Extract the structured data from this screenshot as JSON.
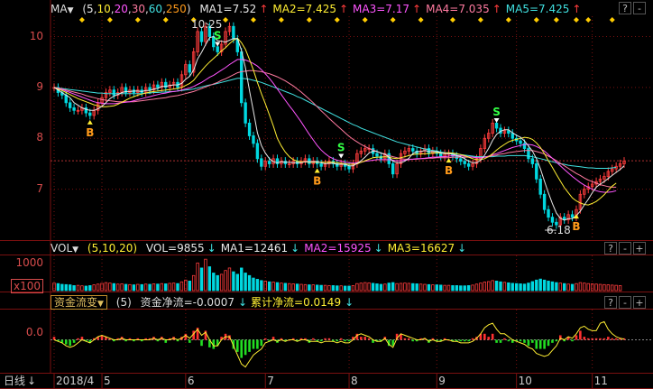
{
  "colors": {
    "background": "#000000",
    "grid_red": "#7a1010",
    "up": "#ff3c3c",
    "down": "#00d8e0",
    "ma1": "#e8e8e8",
    "ma2": "#ffee33",
    "ma3": "#ff55ff",
    "ma4": "#ff7aa0",
    "ma5": "#40e0e0",
    "signal_b": "#ff9a1a",
    "signal_s": "#33ff44",
    "flow_pos": "#ff3030",
    "flow_neg": "#22dd22",
    "flow_line": "#ffee33"
  },
  "price_panel": {
    "indicator_name": "MA",
    "dropdown_icon": "triangle-down-icon",
    "params": [
      "5",
      "10",
      "20",
      "30",
      "60",
      "250"
    ],
    "ma_values": [
      {
        "label": "MA1=7.52",
        "color": "#e8e8e8"
      },
      {
        "label": "MA2=7.425",
        "color": "#ffee33"
      },
      {
        "label": "MA3=7.17",
        "color": "#ff55ff"
      },
      {
        "label": "MA4=7.035",
        "color": "#ff7aa0"
      },
      {
        "label": "MA5=7.425",
        "color": "#40e0e0"
      }
    ],
    "y_ticks": [
      "10",
      "9",
      "8",
      "7"
    ],
    "high_label": "10.25",
    "low_label": "6.18",
    "reference_price": 7.56
  },
  "volume_panel": {
    "indicator_name": "VOL",
    "params": "(5,10,20)",
    "values": [
      {
        "label": "VOL=9855",
        "color": "#e8e8e8"
      },
      {
        "label": "MA1=12461",
        "color": "#e8e8e8"
      },
      {
        "label": "MA2=15925",
        "color": "#ff55ff"
      },
      {
        "label": "MA3=16627",
        "color": "#ffee33"
      }
    ],
    "y_tick": "1000",
    "unit": "x100"
  },
  "flow_panel": {
    "indicator_name": "资金流变",
    "param": "(5)",
    "net_label": "资金净流=-0.0007",
    "cum_label": "累计净流=0.0149",
    "y_tick": "0.0"
  },
  "controls": [
    "?",
    "-",
    "+"
  ],
  "time_axis": {
    "period_label": "日线",
    "period_icon": "arrow-down-icon",
    "ticks": [
      "2018/4",
      "5",
      "6",
      "7",
      "8",
      "9",
      "10",
      "11"
    ]
  },
  "chart_data": {
    "type": "candlestick",
    "title": "",
    "x": [
      "2018/4",
      "5",
      "6",
      "7",
      "8",
      "9",
      "10",
      "11"
    ],
    "price_range": [
      6.0,
      10.4
    ],
    "closes": [
      9.0,
      8.9,
      8.85,
      8.7,
      8.6,
      8.55,
      8.55,
      8.6,
      8.5,
      8.45,
      8.55,
      8.7,
      8.8,
      8.9,
      8.95,
      8.85,
      8.9,
      9.0,
      8.9,
      8.95,
      8.9,
      8.95,
      8.9,
      9.0,
      8.95,
      9.05,
      9.0,
      9.1,
      9.0,
      9.05,
      9.1,
      9.0,
      9.25,
      9.45,
      9.3,
      9.7,
      10.1,
      9.9,
      10.2,
      10.0,
      9.8,
      9.7,
      9.85,
      10.1,
      10.2,
      9.95,
      9.7,
      8.7,
      8.3,
      8.05,
      7.9,
      7.6,
      7.45,
      7.55,
      7.5,
      7.6,
      7.5,
      7.55,
      7.5,
      7.5,
      7.55,
      7.5,
      7.55,
      7.6,
      7.5,
      7.55,
      7.5,
      7.45,
      7.5,
      7.55,
      7.5,
      7.45,
      7.5,
      7.45,
      7.4,
      7.5,
      7.7,
      7.75,
      7.8,
      7.8,
      7.7,
      7.65,
      7.6,
      7.7,
      7.5,
      7.3,
      7.5,
      7.7,
      7.75,
      7.8,
      7.75,
      7.7,
      7.75,
      7.8,
      7.7,
      7.75,
      7.7,
      7.65,
      7.7,
      7.7,
      7.65,
      7.6,
      7.55,
      7.5,
      7.45,
      7.5,
      7.6,
      7.8,
      8.0,
      8.1,
      8.3,
      8.2,
      8.1,
      8.15,
      8.1,
      8.0,
      7.95,
      7.9,
      7.8,
      7.6,
      7.5,
      7.2,
      6.9,
      6.6,
      6.45,
      6.35,
      6.3,
      6.45,
      6.4,
      6.5,
      6.45,
      6.6,
      6.9,
      7.0,
      7.05,
      7.1,
      7.15,
      7.2,
      7.25,
      7.35,
      7.4,
      7.45,
      7.5,
      7.55
    ],
    "ma1": [
      9.0,
      8.95,
      8.9,
      8.85,
      8.8,
      8.7,
      8.65,
      8.6,
      8.57,
      8.55,
      8.55,
      8.58,
      8.63,
      8.7,
      8.78,
      8.83,
      8.86,
      8.9,
      8.92,
      8.92,
      8.93,
      8.93,
      8.92,
      8.94,
      8.94,
      8.97,
      8.98,
      9.02,
      9.02,
      9.04,
      9.05,
      9.05,
      9.08,
      9.16,
      9.22,
      9.34,
      9.56,
      9.69,
      9.84,
      9.98,
      10.0,
      9.92,
      9.91,
      9.89,
      9.93,
      9.96,
      9.96,
      9.73,
      9.39,
      8.94,
      8.53,
      8.11,
      7.86,
      7.71,
      7.6,
      7.54,
      7.52,
      7.54,
      7.53,
      7.53,
      7.52,
      7.52,
      7.52,
      7.54,
      7.54,
      7.54,
      7.54,
      7.52,
      7.5,
      7.51,
      7.51,
      7.49,
      7.49,
      7.49,
      7.46,
      7.46,
      7.51,
      7.56,
      7.63,
      7.71,
      7.75,
      7.74,
      7.71,
      7.69,
      7.63,
      7.55,
      7.52,
      7.52,
      7.55,
      7.61,
      7.7,
      7.74,
      7.74,
      7.76,
      7.74,
      7.74,
      7.74,
      7.72,
      7.7,
      7.7,
      7.69,
      7.66,
      7.64,
      7.6,
      7.55,
      7.52,
      7.52,
      7.57,
      7.67,
      7.8,
      7.96,
      8.08,
      8.14,
      8.17,
      8.17,
      8.11,
      8.06,
      8.02,
      7.95,
      7.85,
      7.75,
      7.6,
      7.4,
      7.16,
      6.93,
      6.72,
      6.53,
      6.43,
      6.39,
      6.42,
      6.42,
      6.48,
      6.57,
      6.69,
      6.8,
      6.93,
      7.04,
      7.1,
      7.15,
      7.21,
      7.27,
      7.33,
      7.39,
      7.46
    ],
    "ma2": [
      9.0,
      8.97,
      8.94,
      8.9,
      8.86,
      8.82,
      8.78,
      8.75,
      8.72,
      8.69,
      8.66,
      8.64,
      8.62,
      8.62,
      8.63,
      8.64,
      8.67,
      8.71,
      8.75,
      8.79,
      8.82,
      8.85,
      8.87,
      8.89,
      8.91,
      8.92,
      8.93,
      8.94,
      8.95,
      8.96,
      8.97,
      8.98,
      9.0,
      9.04,
      9.08,
      9.14,
      9.24,
      9.33,
      9.42,
      9.5,
      9.57,
      9.64,
      9.72,
      9.78,
      9.86,
      9.93,
      9.97,
      9.88,
      9.75,
      9.55,
      9.34,
      9.1,
      8.88,
      8.68,
      8.46,
      8.24,
      8.0,
      7.85,
      7.73,
      7.64,
      7.58,
      7.55,
      7.54,
      7.54,
      7.53,
      7.53,
      7.53,
      7.53,
      7.53,
      7.53,
      7.53,
      7.52,
      7.51,
      7.5,
      7.49,
      7.49,
      7.5,
      7.53,
      7.56,
      7.59,
      7.62,
      7.63,
      7.63,
      7.64,
      7.63,
      7.61,
      7.6,
      7.62,
      7.64,
      7.66,
      7.68,
      7.69,
      7.69,
      7.7,
      7.7,
      7.71,
      7.72,
      7.71,
      7.71,
      7.72,
      7.71,
      7.7,
      7.68,
      7.66,
      7.63,
      7.6,
      7.58,
      7.58,
      7.6,
      7.64,
      7.7,
      7.77,
      7.83,
      7.88,
      7.93,
      7.96,
      7.98,
      8.0,
      8.02,
      8.01,
      7.98,
      7.91,
      7.82,
      7.7,
      7.56,
      7.43,
      7.29,
      7.16,
      7.03,
      6.93,
      6.83,
      6.77,
      6.73,
      6.7,
      6.69,
      6.72,
      6.76,
      6.82,
      6.89,
      6.98,
      7.06,
      7.12
    ],
    "ma3": [
      9.0,
      8.98,
      8.96,
      8.93,
      8.9,
      8.87,
      8.84,
      8.81,
      8.78,
      8.75,
      8.72,
      8.7,
      8.69,
      8.68,
      8.68,
      8.68,
      8.69,
      8.7,
      8.71,
      8.72,
      8.74,
      8.76,
      8.78,
      8.8,
      8.82,
      8.84,
      8.86,
      8.88,
      8.89,
      8.91,
      8.92,
      8.93,
      8.95,
      8.97,
      8.99,
      9.02,
      9.06,
      9.1,
      9.15,
      9.2,
      9.24,
      9.29,
      9.34,
      9.39,
      9.45,
      9.5,
      9.55,
      9.55,
      9.54,
      9.51,
      9.47,
      9.42,
      9.35,
      9.27,
      9.18,
      9.08,
      8.97,
      8.86,
      8.75,
      8.64,
      8.54,
      8.43,
      8.32,
      8.2,
      8.08,
      7.97,
      7.86,
      7.77,
      7.7,
      7.64,
      7.6,
      7.57,
      7.55,
      7.53,
      7.52,
      7.51,
      7.52,
      7.53,
      7.55,
      7.56,
      7.57,
      7.58,
      7.58,
      7.58,
      7.58,
      7.57,
      7.56,
      7.56,
      7.57,
      7.58,
      7.59,
      7.6,
      7.6,
      7.61,
      7.62,
      7.63,
      7.63,
      7.64,
      7.64,
      7.65,
      7.66,
      7.66,
      7.66,
      7.65,
      7.64,
      7.63,
      7.62,
      7.62,
      7.63,
      7.65,
      7.68,
      7.7,
      7.73,
      7.76,
      7.79,
      7.82,
      7.84,
      7.86,
      7.88,
      7.88,
      7.87,
      7.84,
      7.8,
      7.75,
      7.68,
      7.61,
      7.53,
      7.46,
      7.39,
      7.32,
      7.25,
      7.19,
      7.13,
      7.08,
      7.04,
      7.0,
      6.97,
      6.95,
      6.94,
      6.94,
      6.95,
      6.97
    ],
    "ma4": [
      9.0,
      8.99,
      8.97,
      8.95,
      8.93,
      8.91,
      8.89,
      8.87,
      8.84,
      8.82,
      8.8,
      8.78,
      8.76,
      8.75,
      8.74,
      8.73,
      8.72,
      8.72,
      8.72,
      8.72,
      8.72,
      8.73,
      8.74,
      8.75,
      8.76,
      8.77,
      8.78,
      8.79,
      8.8,
      8.82,
      8.83,
      8.84,
      8.86,
      8.88,
      8.9,
      8.92,
      8.95,
      8.98,
      9.01,
      9.04,
      9.07,
      9.1,
      9.14,
      9.17,
      9.21,
      9.25,
      9.29,
      9.31,
      9.32,
      9.33,
      9.33,
      9.32,
      9.31,
      9.29,
      9.27,
      9.24,
      9.21,
      9.17,
      9.13,
      9.08,
      9.03,
      8.97,
      8.91,
      8.84,
      8.77,
      8.7,
      8.62,
      8.54,
      8.47,
      8.39,
      8.32,
      8.25,
      8.18,
      8.11,
      8.04,
      7.98,
      7.93,
      7.88,
      7.84,
      7.8,
      7.77,
      7.74,
      7.71,
      7.68,
      7.66,
      7.64,
      7.62,
      7.6,
      7.59,
      7.59,
      7.59,
      7.59,
      7.6,
      7.6,
      7.61,
      7.61,
      7.62,
      7.62,
      7.62,
      7.62,
      7.63,
      7.63,
      7.63,
      7.63,
      7.63,
      7.63,
      7.62,
      7.62,
      7.63,
      7.64,
      7.66,
      7.67,
      7.69,
      7.7,
      7.72,
      7.73,
      7.74,
      7.75,
      7.76,
      7.76,
      7.76,
      7.74,
      7.72,
      7.69,
      7.65,
      7.61,
      7.56,
      7.51,
      7.46,
      7.41,
      7.36,
      7.31,
      7.27,
      7.22,
      7.18,
      7.15,
      7.12,
      7.09,
      7.07,
      7.05,
      7.04,
      7.04
    ],
    "ma5": [
      9.0,
      8.99,
      8.98,
      8.97,
      8.96,
      8.95,
      8.94,
      8.93,
      8.92,
      8.91,
      8.9,
      8.89,
      8.89,
      8.88,
      8.88,
      8.88,
      8.88,
      8.88,
      8.88,
      8.88,
      8.88,
      8.88,
      8.88,
      8.89,
      8.89,
      8.9,
      8.9,
      8.91,
      8.91,
      8.92,
      8.92,
      8.93,
      8.94,
      8.95,
      8.96,
      8.97,
      8.99,
      9.01,
      9.03,
      9.05,
      9.06,
      9.08,
      9.1,
      9.12,
      9.14,
      9.16,
      9.18,
      9.18,
      9.17,
      9.16,
      9.14,
      9.12,
      9.1,
      9.07,
      9.04,
      9.01,
      8.98,
      8.95,
      8.92,
      8.89,
      8.86,
      8.82,
      8.79,
      8.75,
      8.71,
      8.67,
      8.63,
      8.59,
      8.55,
      8.51,
      8.47,
      8.43,
      8.39,
      8.35,
      8.31,
      8.27,
      8.24,
      8.2,
      8.17,
      8.14,
      8.11,
      8.08,
      8.05,
      8.02,
      7.99,
      7.96,
      7.93,
      7.91,
      7.89,
      7.87,
      7.85,
      7.83,
      7.81,
      7.79,
      7.78,
      7.76,
      7.75,
      7.73,
      7.72,
      7.71,
      7.7,
      7.69,
      7.68,
      7.67,
      7.66,
      7.65,
      7.64,
      7.64,
      7.64,
      7.64,
      7.64,
      7.65,
      7.65,
      7.65,
      7.66,
      7.66,
      7.66,
      7.66,
      7.66,
      7.65,
      7.64,
      7.62,
      7.6,
      7.58,
      7.56,
      7.54,
      7.52,
      7.5,
      7.49,
      7.47,
      7.46,
      7.45,
      7.44,
      7.43,
      7.42,
      7.42,
      7.41,
      7.41,
      7.41,
      7.41,
      7.42,
      7.43
    ],
    "volume_range": [
      0,
      1400
    ],
    "volumes": [
      300,
      280,
      250,
      240,
      230,
      200,
      210,
      190,
      180,
      200,
      230,
      260,
      290,
      320,
      300,
      280,
      260,
      270,
      250,
      240,
      230,
      250,
      240,
      260,
      250,
      270,
      260,
      280,
      270,
      290,
      300,
      280,
      350,
      420,
      380,
      600,
      1100,
      900,
      1250,
      950,
      700,
      600,
      650,
      800,
      900,
      750,
      650,
      900,
      700,
      600,
      500,
      450,
      400,
      380,
      350,
      340,
      320,
      300,
      290,
      280,
      270,
      260,
      250,
      240,
      230,
      230,
      220,
      210,
      210,
      200,
      200,
      190,
      190,
      180,
      180,
      200,
      280,
      300,
      320,
      310,
      290,
      270,
      250,
      260,
      300,
      320,
      280,
      290,
      300,
      290,
      280,
      270,
      260,
      250,
      240,
      230,
      230,
      220,
      210,
      210,
      200,
      200,
      190,
      190,
      200,
      220,
      260,
      300,
      340,
      360,
      400,
      380,
      350,
      330,
      310,
      290,
      280,
      270,
      260,
      300,
      360,
      420,
      460,
      420,
      380,
      350,
      320,
      300,
      280,
      260,
      250,
      280,
      320,
      300,
      280,
      270,
      260,
      250,
      240,
      230,
      220,
      210,
      200
    ],
    "flow_range": [
      -1.0,
      1.0
    ],
    "flow_bars": [
      0.1,
      -0.05,
      -0.1,
      -0.15,
      -0.2,
      -0.1,
      0.05,
      0.1,
      -0.05,
      -0.1,
      0.05,
      0.1,
      0.15,
      0.1,
      0.05,
      -0.05,
      0.05,
      0.1,
      -0.05,
      0.05,
      -0.05,
      0.05,
      -0.05,
      0.05,
      0.05,
      0.1,
      -0.05,
      0.1,
      -0.1,
      0.05,
      0.1,
      -0.05,
      0.1,
      0.2,
      -0.1,
      0.3,
      0.4,
      -0.2,
      0.3,
      -0.25,
      -0.3,
      -0.2,
      0.1,
      0.2,
      0.15,
      -0.3,
      -0.4,
      -0.6,
      -0.5,
      -0.4,
      -0.3,
      -0.3,
      -0.2,
      0.05,
      -0.05,
      0.1,
      -0.1,
      0.05,
      -0.05,
      0.0,
      0.05,
      -0.05,
      0.05,
      0.05,
      -0.1,
      0.05,
      -0.05,
      -0.05,
      0.05,
      0.05,
      -0.05,
      -0.05,
      0.05,
      -0.05,
      -0.05,
      0.1,
      0.2,
      0.1,
      0.1,
      0.05,
      -0.1,
      -0.05,
      -0.05,
      0.1,
      -0.2,
      -0.2,
      0.2,
      0.2,
      0.05,
      0.05,
      -0.05,
      -0.05,
      0.05,
      0.05,
      -0.1,
      0.05,
      -0.05,
      -0.05,
      0.05,
      0.0,
      -0.05,
      -0.05,
      -0.05,
      -0.05,
      -0.05,
      0.05,
      0.1,
      0.2,
      0.2,
      0.1,
      0.2,
      -0.1,
      -0.1,
      0.05,
      -0.05,
      -0.1,
      -0.05,
      -0.05,
      -0.1,
      -0.2,
      -0.1,
      -0.3,
      -0.3,
      -0.3,
      -0.2,
      -0.1,
      -0.05,
      0.15,
      -0.05,
      0.1,
      -0.05,
      0.15,
      0.3,
      0.1,
      0.05,
      0.05,
      0.05,
      0.05,
      0.05,
      0.1,
      0.05,
      0.05,
      0.05,
      0.05
    ],
    "flow_line": [
      0.0,
      -0.05,
      -0.1,
      -0.2,
      -0.25,
      -0.2,
      -0.1,
      0.0,
      -0.05,
      -0.1,
      0.0,
      0.1,
      0.15,
      0.1,
      0.05,
      0.0,
      0.0,
      0.05,
      0.0,
      0.0,
      0.0,
      0.0,
      0.0,
      0.0,
      0.0,
      0.05,
      0.0,
      0.05,
      0.0,
      0.0,
      0.05,
      0.0,
      0.05,
      0.15,
      0.05,
      0.2,
      0.35,
      0.15,
      0.25,
      0.0,
      -0.2,
      -0.2,
      0.0,
      0.1,
      0.1,
      -0.2,
      -0.5,
      -0.8,
      -0.9,
      -0.7,
      -0.5,
      -0.4,
      -0.3,
      -0.1,
      -0.05,
      0.0,
      -0.05,
      0.0,
      -0.05,
      0.0,
      0.0,
      -0.05,
      0.0,
      0.0,
      -0.05,
      -0.05,
      -0.05,
      -0.1,
      -0.05,
      -0.05,
      -0.05,
      -0.1,
      -0.05,
      -0.1,
      -0.1,
      0.0,
      0.15,
      0.2,
      0.15,
      0.1,
      0.0,
      -0.05,
      -0.05,
      0.05,
      -0.15,
      -0.25,
      0.05,
      0.2,
      0.15,
      0.1,
      0.05,
      0.0,
      0.0,
      0.05,
      -0.05,
      0.0,
      -0.05,
      -0.05,
      0.0,
      0.0,
      -0.05,
      -0.05,
      -0.1,
      -0.1,
      -0.1,
      -0.05,
      0.05,
      0.2,
      0.4,
      0.5,
      0.55,
      0.35,
      0.2,
      0.2,
      0.1,
      0.0,
      -0.05,
      -0.1,
      -0.15,
      -0.25,
      -0.3,
      -0.45,
      -0.5,
      -0.55,
      -0.5,
      -0.35,
      -0.2,
      0.05,
      0.0,
      0.1,
      0.05,
      0.2,
      0.4,
      0.45,
      0.35,
      0.3,
      0.3,
      0.55,
      0.6,
      0.35,
      0.2,
      0.1,
      0.05,
      0.02
    ],
    "signals": [
      {
        "type": "B",
        "index": 9
      },
      {
        "type": "S",
        "index": 41
      },
      {
        "type": "B",
        "index": 66
      },
      {
        "type": "S",
        "index": 72
      },
      {
        "type": "B",
        "index": 99
      },
      {
        "type": "S",
        "index": 111
      },
      {
        "type": "B",
        "index": 131
      }
    ],
    "marker_indices": [
      7,
      14,
      21,
      28,
      35,
      43,
      50,
      57,
      64,
      71,
      78,
      85,
      92,
      100,
      107,
      114,
      121,
      126,
      131,
      134,
      140
    ],
    "tick_indices": [
      0,
      12,
      33,
      53,
      74,
      96,
      116,
      135
    ]
  }
}
